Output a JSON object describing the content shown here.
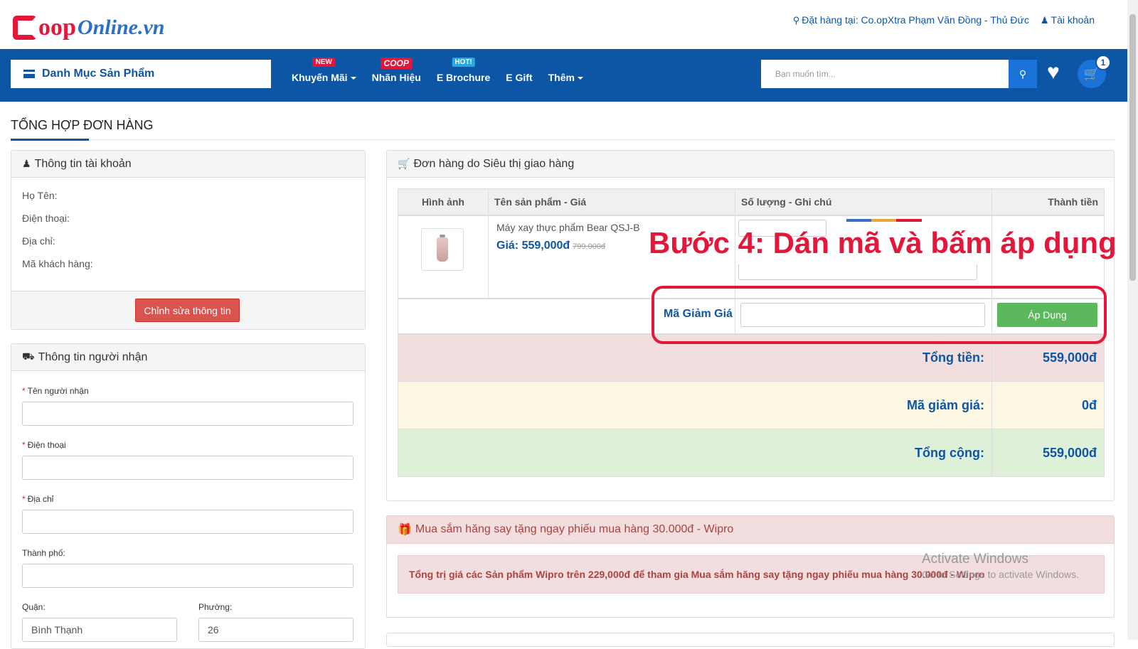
{
  "brand": {
    "logo_c": "C",
    "logo_oop": "oop",
    "logo_online": "Online.vn",
    "red": "#e4173b",
    "blue": "#0d56a6"
  },
  "topbar": {
    "store": "Đặt hàng tại: Co.opXtra Phạm Văn Đồng - Thủ Đức",
    "account": "Tài khoản",
    "store_icon": "map-marker-icon",
    "account_icon": "user-icon"
  },
  "nav": {
    "category_label": "Danh Mục Sản Phẩm",
    "items": [
      {
        "label": "Khuyến Mãi",
        "badge": "NEW"
      },
      {
        "label": "Nhãn Hiệu",
        "badge": "COOP"
      },
      {
        "label": "E Brochure",
        "badge": "HOT!"
      },
      {
        "label": "E Gift",
        "badge": ""
      },
      {
        "label": "Thêm",
        "badge": ""
      }
    ],
    "search_placeholder": "Bạn muốn tìm...",
    "cart_count": "1"
  },
  "page_title": "TỔNG HỢP ĐƠN HÀNG",
  "account_panel": {
    "title": "Thông tin tài khoản",
    "fields": [
      "Họ Tên:",
      "Điện thoại:",
      "Địa chỉ:",
      "Mã khách hàng:"
    ],
    "edit_button": "Chỉnh sửa thông tin"
  },
  "recipient_panel": {
    "title": "Thông tin người nhận",
    "name_label": "Tên người nhận",
    "phone_label": "Điện thoại",
    "address_label": "Địa chỉ",
    "city_label": "Thành phố:",
    "district_label": "Quận:",
    "ward_label": "Phường:",
    "district_value": "Bình Thạnh",
    "ward_value": "26",
    "required_mark": "*"
  },
  "order_panel": {
    "title": "Đơn hàng do Siêu thị giao hàng",
    "columns": [
      "Hình ảnh",
      "Tên sản phẩm - Giá",
      "Số lượng - Ghi chú",
      "Thành tiền"
    ],
    "product": {
      "name": "Máy xay thực phẩm Bear QSJ-B",
      "price": "Giá: 559,000đ",
      "old_price": "799,000đ"
    },
    "coupon_label": "Mã Giảm Giá",
    "apply_button": "Áp Dụng",
    "summary": [
      {
        "label": "Tổng tiền:",
        "value": "559,000đ",
        "bg": "#f2dede"
      },
      {
        "label": "Mã giảm giá:",
        "value": "0đ",
        "bg": "#fcf8e3"
      },
      {
        "label": "Tổng cộng:",
        "value": "559,000đ",
        "bg": "#dff0d8"
      }
    ]
  },
  "annotation": "Bước 4: Dán mã và bấm áp dụng",
  "promo": {
    "title": "Mua sắm hăng say tặng ngay phiếu mua hàng 30.000đ - Wipro",
    "message": "Tổng trị giá các Sản phẩm Wipro trên 229,000đ để tham gia Mua sắm hăng say tặng ngay phiếu mua hàng 30.000đ - Wipro"
  },
  "watermark": {
    "line1": "Activate Windows",
    "line2": "Go to Settings to activate Windows."
  }
}
